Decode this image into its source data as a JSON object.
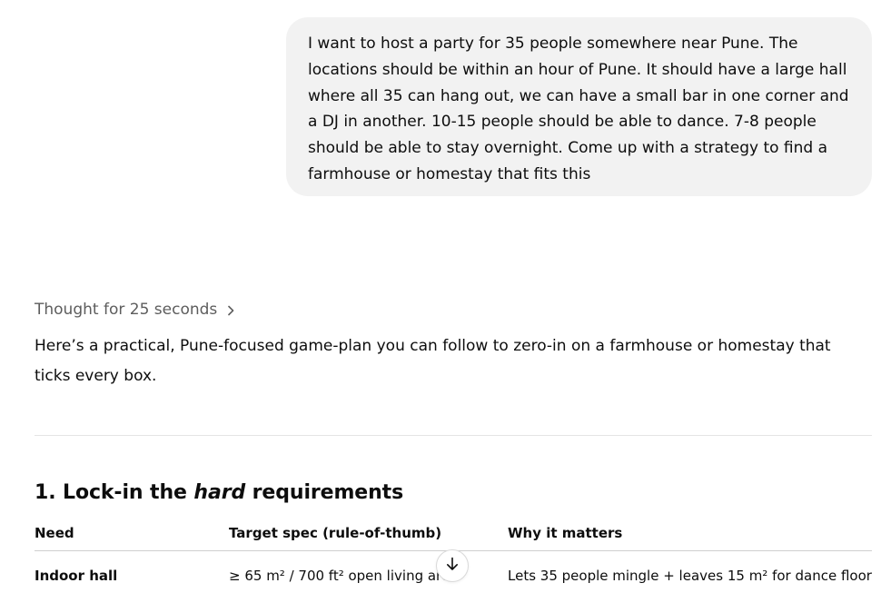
{
  "user_message": {
    "text": "I want to host a party for 35 people somewhere near Pune. The locations should be within an hour of Pune. It should have a large hall where all 35 can hang out, we can have a small bar in one corner and a DJ in another. 10-15 people should be able to dance. 7-8 people should be able to stay overnight. Come up with a strategy to find a farmhouse or homestay that fits this"
  },
  "assistant": {
    "thought_label": "Thought for 25 seconds",
    "intro": "Here’s a practical, Pune-focused game-plan you can follow to zero-in on a farmhouse or homestay that ticks every box.",
    "section1": {
      "prefix": "1. Lock-in the ",
      "emphasis": "hard",
      "suffix": " requirements"
    },
    "table": {
      "headers": [
        "Need",
        "Target spec (rule-of-thumb)",
        "Why it matters"
      ],
      "rows": [
        {
          "need": "Indoor hall",
          "spec": "≥ 65 m² / 700 ft² open living area",
          "why": "Lets 35 people mingle + leaves 15 m² for dance floor"
        }
      ]
    }
  },
  "icons": {
    "thought_chevron": "chevron-right-icon",
    "scroll_button": "arrow-down-icon"
  },
  "colors": {
    "user_bubble_bg": "#f2f2f2",
    "muted_text": "#5d5d5d",
    "text": "#0d0d0d"
  }
}
